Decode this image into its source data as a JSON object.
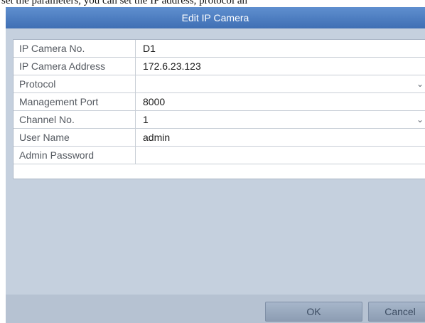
{
  "page_header": {
    "text": "set the parameters, you can set the IP address, protocol an"
  },
  "dialog": {
    "title": "Edit IP Camera"
  },
  "form": {
    "rows": [
      {
        "label": "IP Camera No.",
        "value": "D1"
      },
      {
        "label": "IP Camera Address",
        "value": "172.6.23.123"
      },
      {
        "label": "Protocol",
        "value": ""
      },
      {
        "label": "Management Port",
        "value": "8000"
      },
      {
        "label": "Channel No.",
        "value": "1"
      },
      {
        "label": "User Name",
        "value": "admin"
      },
      {
        "label": "Admin Password",
        "value": ""
      }
    ]
  },
  "footer": {
    "ok_label": "OK",
    "cancel_label": "Cancel"
  },
  "icons": {
    "dropdown": "chevron-down-icon"
  },
  "colors": {
    "title_bar": "#4a7cc2",
    "dialog_bg": "#c5d0de",
    "footer_bg": "#b6c2d2"
  }
}
